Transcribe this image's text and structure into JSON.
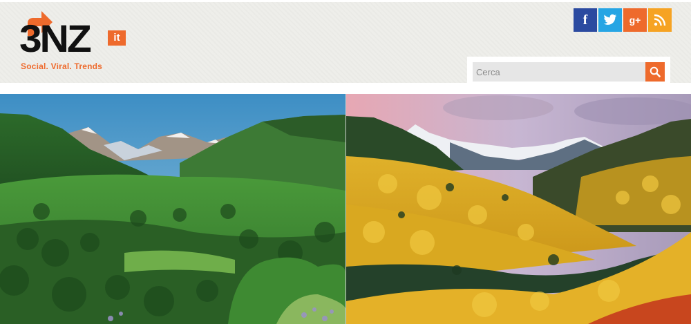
{
  "site": {
    "logo_text": "3NZ",
    "logo_tld": "it",
    "tagline": "Social. Viral. Trends"
  },
  "social": [
    {
      "name": "facebook",
      "icon": "facebook-icon",
      "color": "#2b4aa0"
    },
    {
      "name": "twitter",
      "icon": "twitter-icon",
      "color": "#26a5e4"
    },
    {
      "name": "google-plus",
      "icon": "google-plus-icon",
      "color": "#ee6a2c"
    },
    {
      "name": "rss",
      "icon": "rss-icon",
      "color": "#f6a323"
    }
  ],
  "search": {
    "placeholder": "Cerca",
    "value": "",
    "button_icon": "search-icon"
  },
  "hero": {
    "left_image": "summer-green-mountain-valley",
    "right_image": "autumn-yellow-aspen-mountain-valley"
  },
  "colors": {
    "accent": "#ee6a2c",
    "header_bg": "#eeeeea",
    "facebook": "#2b4aa0",
    "twitter": "#26a5e4",
    "rss": "#f6a323"
  }
}
